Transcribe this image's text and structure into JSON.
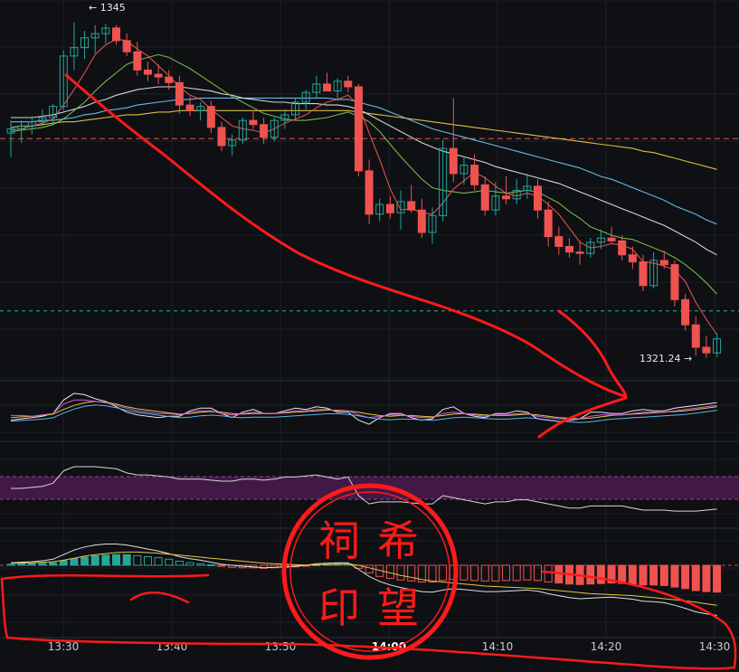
{
  "chart_data": {
    "type": "candlestick",
    "x_ticks": [
      "13:30",
      "13:40",
      "13:50",
      "14:00",
      "14:10",
      "14:20",
      "14:30"
    ],
    "bold_tick": "14:00",
    "annotations": {
      "high_label": "← 1345",
      "low_label": "1321.24 →"
    },
    "reference_lines": {
      "red_dashed": 1336.9,
      "green_dashed": 1324.6
    },
    "colors": {
      "up": "#26a69a",
      "down": "#ef5350",
      "ma5": "#ef5350",
      "ma10": "#7cc14a",
      "ma20": "#e0e0e0",
      "ma30": "#6ec3f4",
      "ma60": "#e8c547",
      "macd_pos": "#26a69a",
      "macd_neg": "#ef5350",
      "rsi_band": "#4a1a4f",
      "annotation_red": "#ff1a1a"
    },
    "candles": [
      [
        1337.3,
        1338.2,
        1335.6,
        1337.6
      ],
      [
        1337.6,
        1338.2,
        1336.6,
        1337.8
      ],
      [
        1337.8,
        1338.5,
        1337.2,
        1338.1
      ],
      [
        1338.1,
        1339.0,
        1337.8,
        1338.4
      ],
      [
        1338.4,
        1339.4,
        1338.0,
        1339.2
      ],
      [
        1339.2,
        1343.2,
        1338.9,
        1342.8
      ],
      [
        1342.8,
        1345.2,
        1341.8,
        1343.4
      ],
      [
        1343.4,
        1344.6,
        1342.6,
        1344.1
      ],
      [
        1344.1,
        1345.0,
        1343.0,
        1344.4
      ],
      [
        1344.4,
        1345.1,
        1343.7,
        1344.8
      ],
      [
        1344.8,
        1345.0,
        1343.6,
        1343.9
      ],
      [
        1343.9,
        1344.4,
        1342.8,
        1343.1
      ],
      [
        1343.1,
        1343.8,
        1341.4,
        1341.8
      ],
      [
        1341.8,
        1342.4,
        1341.0,
        1341.5
      ],
      [
        1341.5,
        1342.2,
        1340.8,
        1341.3
      ],
      [
        1341.3,
        1341.8,
        1340.4,
        1340.9
      ],
      [
        1340.9,
        1341.4,
        1338.7,
        1339.3
      ],
      [
        1339.3,
        1339.9,
        1338.5,
        1338.9
      ],
      [
        1338.9,
        1339.5,
        1338.2,
        1339.2
      ],
      [
        1339.2,
        1339.6,
        1337.3,
        1337.7
      ],
      [
        1337.7,
        1338.1,
        1336.0,
        1336.4
      ],
      [
        1336.4,
        1337.2,
        1335.7,
        1336.8
      ],
      [
        1336.8,
        1338.4,
        1336.5,
        1338.2
      ],
      [
        1338.2,
        1338.9,
        1337.6,
        1337.9
      ],
      [
        1337.9,
        1338.4,
        1336.5,
        1337.0
      ],
      [
        1337.0,
        1338.4,
        1336.7,
        1338.2
      ],
      [
        1338.2,
        1339.0,
        1337.6,
        1338.6
      ],
      [
        1338.6,
        1339.8,
        1338.2,
        1339.5
      ],
      [
        1339.5,
        1340.4,
        1339.0,
        1340.2
      ],
      [
        1340.2,
        1341.4,
        1339.8,
        1340.8
      ],
      [
        1340.8,
        1341.6,
        1340.4,
        1340.3
      ],
      [
        1340.3,
        1341.2,
        1339.6,
        1341.0
      ],
      [
        1341.0,
        1341.4,
        1340.2,
        1340.6
      ],
      [
        1340.6,
        1340.8,
        1334.2,
        1334.6
      ],
      [
        1334.6,
        1335.4,
        1330.8,
        1331.5
      ],
      [
        1331.5,
        1332.6,
        1331.0,
        1332.2
      ],
      [
        1332.2,
        1332.8,
        1331.2,
        1331.6
      ],
      [
        1331.6,
        1333.2,
        1330.4,
        1332.4
      ],
      [
        1332.4,
        1333.6,
        1331.6,
        1331.8
      ],
      [
        1331.8,
        1332.6,
        1329.8,
        1330.2
      ],
      [
        1330.2,
        1332.0,
        1329.4,
        1331.4
      ],
      [
        1331.4,
        1336.8,
        1331.0,
        1336.2
      ],
      [
        1336.2,
        1339.8,
        1333.8,
        1334.4
      ],
      [
        1334.4,
        1335.6,
        1333.6,
        1335.0
      ],
      [
        1335.0,
        1335.8,
        1333.2,
        1333.6
      ],
      [
        1333.6,
        1334.2,
        1331.4,
        1331.8
      ],
      [
        1331.8,
        1333.8,
        1331.4,
        1332.8
      ],
      [
        1332.8,
        1334.2,
        1332.2,
        1332.6
      ],
      [
        1332.6,
        1334.0,
        1332.2,
        1333.2
      ],
      [
        1333.2,
        1334.4,
        1332.6,
        1333.5
      ],
      [
        1333.5,
        1334.0,
        1331.2,
        1331.8
      ],
      [
        1331.8,
        1332.4,
        1329.2,
        1329.9
      ],
      [
        1329.9,
        1330.6,
        1328.6,
        1329.2
      ],
      [
        1329.2,
        1329.8,
        1328.4,
        1328.8
      ],
      [
        1328.8,
        1329.6,
        1327.9,
        1328.7
      ],
      [
        1328.7,
        1329.8,
        1328.4,
        1329.5
      ],
      [
        1329.5,
        1330.4,
        1329.0,
        1329.8
      ],
      [
        1329.8,
        1330.6,
        1329.4,
        1329.6
      ],
      [
        1329.6,
        1330.0,
        1328.2,
        1328.6
      ],
      [
        1328.6,
        1329.2,
        1327.6,
        1328.1
      ],
      [
        1328.1,
        1328.6,
        1326.0,
        1326.4
      ],
      [
        1326.4,
        1328.8,
        1326.2,
        1328.2
      ],
      [
        1328.2,
        1328.9,
        1327.6,
        1327.9
      ],
      [
        1327.9,
        1328.2,
        1324.9,
        1325.4
      ],
      [
        1325.4,
        1325.8,
        1323.2,
        1323.6
      ],
      [
        1323.6,
        1324.2,
        1321.4,
        1322.0
      ],
      [
        1322.0,
        1322.8,
        1321.24,
        1321.6
      ],
      [
        1321.6,
        1323.0,
        1321.3,
        1322.6
      ]
    ],
    "ma5": [
      1337.5,
      1337.6,
      1337.8,
      1338.0,
      1338.3,
      1339.3,
      1340.4,
      1341.6,
      1342.9,
      1343.6,
      1344.0,
      1343.9,
      1343.3,
      1342.8,
      1342.1,
      1341.4,
      1340.6,
      1340.0,
      1339.7,
      1339.0,
      1338.4,
      1337.8,
      1337.6,
      1337.5,
      1337.3,
      1337.6,
      1338.0,
      1338.3,
      1338.6,
      1339.1,
      1339.5,
      1339.7,
      1340.0,
      1339.3,
      1337.3,
      1335.4,
      1333.3,
      1331.8,
      1331.9,
      1331.6,
      1331.5,
      1332.3,
      1333.3,
      1333.9,
      1334.5,
      1334.1,
      1333.5,
      1333.0,
      1332.8,
      1333.0,
      1332.8,
      1332.2,
      1331.5,
      1330.5,
      1329.5,
      1329.1,
      1329.2,
      1329.4,
      1329.3,
      1329.0,
      1328.1,
      1328.0,
      1327.8,
      1327.5,
      1326.7,
      1325.2,
      1324.0,
      1322.9
    ],
    "ma10": [
      1337.4,
      1337.5,
      1337.6,
      1337.7,
      1337.9,
      1338.3,
      1338.9,
      1339.5,
      1340.3,
      1341.0,
      1341.6,
      1342.2,
      1342.5,
      1342.7,
      1342.9,
      1342.7,
      1342.3,
      1341.9,
      1341.4,
      1340.9,
      1340.4,
      1339.9,
      1339.5,
      1339.1,
      1338.7,
      1338.5,
      1338.3,
      1338.2,
      1338.2,
      1338.3,
      1338.4,
      1338.6,
      1338.8,
      1338.5,
      1338.1,
      1337.4,
      1336.5,
      1335.6,
      1334.8,
      1334.0,
      1333.4,
      1333.2,
      1333.1,
      1333.0,
      1333.1,
      1333.2,
      1333.1,
      1333.0,
      1333.1,
      1333.2,
      1333.1,
      1332.7,
      1332.3,
      1331.7,
      1331.2,
      1330.6,
      1330.3,
      1330.0,
      1329.8,
      1329.7,
      1329.4,
      1329.1,
      1328.8,
      1328.4,
      1327.9,
      1327.3,
      1326.6,
      1325.8
    ],
    "ma20": [
      1338.4,
      1338.4,
      1338.4,
      1338.5,
      1338.6,
      1338.8,
      1339.0,
      1339.2,
      1339.5,
      1339.7,
      1340.0,
      1340.2,
      1340.4,
      1340.5,
      1340.6,
      1340.6,
      1340.6,
      1340.5,
      1340.4,
      1340.3,
      1340.1,
      1340.0,
      1339.8,
      1339.7,
      1339.6,
      1339.5,
      1339.5,
      1339.4,
      1339.4,
      1339.4,
      1339.3,
      1339.3,
      1339.2,
      1339.0,
      1338.6,
      1338.2,
      1337.8,
      1337.4,
      1337.0,
      1336.6,
      1336.3,
      1336.0,
      1335.8,
      1335.6,
      1335.4,
      1335.2,
      1334.9,
      1334.7,
      1334.5,
      1334.3,
      1334.1,
      1333.9,
      1333.7,
      1333.4,
      1333.1,
      1332.8,
      1332.5,
      1332.2,
      1331.9,
      1331.6,
      1331.3,
      1331.0,
      1330.7,
      1330.3,
      1329.9,
      1329.5,
      1329.0,
      1328.6
    ],
    "ma30": [
      1338.1,
      1338.1,
      1338.1,
      1338.2,
      1338.2,
      1338.3,
      1338.4,
      1338.6,
      1338.7,
      1338.9,
      1339.0,
      1339.1,
      1339.3,
      1339.4,
      1339.5,
      1339.6,
      1339.7,
      1339.7,
      1339.8,
      1339.8,
      1339.8,
      1339.8,
      1339.8,
      1339.8,
      1339.8,
      1339.8,
      1339.8,
      1339.8,
      1339.8,
      1339.8,
      1339.8,
      1339.7,
      1339.7,
      1339.5,
      1339.3,
      1339.1,
      1338.8,
      1338.5,
      1338.2,
      1337.9,
      1337.6,
      1337.4,
      1337.2,
      1337.0,
      1336.8,
      1336.6,
      1336.4,
      1336.2,
      1336.0,
      1335.8,
      1335.6,
      1335.4,
      1335.2,
      1335.0,
      1334.8,
      1334.5,
      1334.2,
      1334.0,
      1333.7,
      1333.4,
      1333.1,
      1332.8,
      1332.5,
      1332.1,
      1331.8,
      1331.5,
      1331.1,
      1330.8
    ],
    "ma60": [
      1337.7,
      1337.8,
      1337.8,
      1337.9,
      1338.0,
      1338.1,
      1338.1,
      1338.2,
      1338.3,
      1338.4,
      1338.5,
      1338.6,
      1338.6,
      1338.7,
      1338.8,
      1338.8,
      1338.9,
      1338.9,
      1338.9,
      1338.9,
      1338.9,
      1338.9,
      1338.9,
      1338.9,
      1338.9,
      1338.9,
      1338.9,
      1338.9,
      1338.9,
      1338.9,
      1338.9,
      1338.9,
      1338.9,
      1338.8,
      1338.7,
      1338.6,
      1338.5,
      1338.4,
      1338.3,
      1338.2,
      1338.1,
      1338.0,
      1337.9,
      1337.8,
      1337.7,
      1337.6,
      1337.5,
      1337.4,
      1337.3,
      1337.2,
      1337.1,
      1337.0,
      1336.9,
      1336.8,
      1336.7,
      1336.6,
      1336.5,
      1336.4,
      1336.3,
      1336.2,
      1336.0,
      1335.9,
      1335.7,
      1335.5,
      1335.3,
      1335.1,
      1334.9,
      1334.7
    ],
    "stoch_k": [
      55,
      55,
      54,
      56,
      58,
      72,
      78,
      78,
      76,
      74,
      70,
      66,
      62,
      60,
      58,
      58,
      56,
      60,
      62,
      62,
      58,
      56,
      58,
      60,
      58,
      58,
      60,
      62,
      62,
      64,
      64,
      62,
      62,
      56,
      52,
      54,
      56,
      56,
      54,
      52,
      52,
      58,
      60,
      58,
      56,
      54,
      56,
      56,
      58,
      58,
      54,
      52,
      50,
      50,
      50,
      54,
      56,
      56,
      56,
      58,
      60,
      60,
      60,
      62,
      64,
      66,
      68,
      70
    ],
    "stoch_d": [
      52,
      53,
      54,
      55,
      57,
      64,
      70,
      74,
      76,
      75,
      72,
      68,
      65,
      63,
      61,
      59,
      57,
      58,
      60,
      61,
      60,
      58,
      57,
      58,
      58,
      58,
      59,
      60,
      61,
      62,
      63,
      63,
      62,
      60,
      57,
      55,
      54,
      55,
      55,
      54,
      53,
      55,
      57,
      58,
      57,
      56,
      55,
      55,
      56,
      57,
      56,
      54,
      52,
      51,
      50,
      51,
      53,
      55,
      56,
      57,
      58,
      59,
      60,
      61,
      62,
      64,
      66,
      68
    ],
    "stoch_j": [
      48,
      50,
      52,
      54,
      58,
      78,
      88,
      86,
      80,
      76,
      68,
      60,
      56,
      54,
      52,
      54,
      54,
      62,
      66,
      66,
      58,
      52,
      60,
      64,
      58,
      58,
      62,
      66,
      64,
      68,
      66,
      60,
      60,
      48,
      42,
      52,
      58,
      58,
      52,
      48,
      50,
      64,
      68,
      58,
      54,
      52,
      58,
      58,
      62,
      60,
      50,
      48,
      46,
      48,
      50,
      60,
      60,
      58,
      58,
      62,
      64,
      62,
      62,
      66,
      68,
      70,
      72,
      74
    ],
    "rsi": [
      55,
      55,
      56,
      57,
      60,
      72,
      76,
      76,
      76,
      75,
      74,
      70,
      68,
      68,
      67,
      66,
      64,
      64,
      64,
      63,
      62,
      62,
      64,
      64,
      63,
      64,
      66,
      66,
      67,
      68,
      66,
      64,
      66,
      48,
      40,
      42,
      42,
      42,
      41,
      40,
      40,
      48,
      46,
      44,
      42,
      40,
      42,
      42,
      44,
      44,
      42,
      40,
      38,
      36,
      36,
      38,
      38,
      38,
      38,
      36,
      34,
      34,
      34,
      33,
      33,
      33,
      34,
      35
    ],
    "macd_hist": [
      0.04,
      0.05,
      0.06,
      0.08,
      0.1,
      0.18,
      0.26,
      0.32,
      0.38,
      0.4,
      0.42,
      0.42,
      0.38,
      0.34,
      0.3,
      0.24,
      0.16,
      0.1,
      0.06,
      0.02,
      -0.04,
      -0.08,
      -0.1,
      -0.1,
      -0.12,
      -0.1,
      -0.08,
      -0.06,
      -0.02,
      0.02,
      0.04,
      0.06,
      0.06,
      -0.12,
      -0.3,
      -0.44,
      -0.52,
      -0.58,
      -0.62,
      -0.66,
      -0.66,
      -0.6,
      -0.56,
      -0.58,
      -0.6,
      -0.62,
      -0.62,
      -0.6,
      -0.6,
      -0.58,
      -0.6,
      -0.66,
      -0.7,
      -0.74,
      -0.76,
      -0.74,
      -0.72,
      -0.7,
      -0.72,
      -0.74,
      -0.78,
      -0.78,
      -0.8,
      -0.86,
      -0.92,
      -1.0,
      -1.04,
      -1.06
    ],
    "macd_dif": [
      0.1,
      0.12,
      0.14,
      0.18,
      0.24,
      0.42,
      0.6,
      0.72,
      0.8,
      0.84,
      0.84,
      0.8,
      0.72,
      0.64,
      0.56,
      0.46,
      0.34,
      0.26,
      0.2,
      0.12,
      0.04,
      0.0,
      -0.04,
      -0.06,
      -0.1,
      -0.08,
      -0.06,
      -0.04,
      0.0,
      0.06,
      0.08,
      0.1,
      0.1,
      -0.16,
      -0.44,
      -0.64,
      -0.78,
      -0.88,
      -0.96,
      -1.04,
      -1.06,
      -0.98,
      -0.92,
      -0.96,
      -1.0,
      -1.04,
      -1.04,
      -1.02,
      -1.0,
      -0.98,
      -1.02,
      -1.12,
      -1.2,
      -1.28,
      -1.32,
      -1.3,
      -1.28,
      -1.26,
      -1.3,
      -1.34,
      -1.42,
      -1.44,
      -1.48,
      -1.58,
      -1.7,
      -1.84,
      -1.92,
      -1.98
    ],
    "macd_dea": [
      0.08,
      0.09,
      0.1,
      0.12,
      0.14,
      0.2,
      0.28,
      0.36,
      0.42,
      0.46,
      0.5,
      0.52,
      0.52,
      0.5,
      0.48,
      0.44,
      0.4,
      0.36,
      0.32,
      0.28,
      0.24,
      0.2,
      0.16,
      0.12,
      0.08,
      0.06,
      0.04,
      0.02,
      0.01,
      0.02,
      0.03,
      0.04,
      0.05,
      0.0,
      -0.1,
      -0.2,
      -0.3,
      -0.4,
      -0.48,
      -0.56,
      -0.62,
      -0.66,
      -0.7,
      -0.74,
      -0.78,
      -0.82,
      -0.84,
      -0.86,
      -0.88,
      -0.9,
      -0.92,
      -0.96,
      -1.0,
      -1.04,
      -1.08,
      -1.12,
      -1.14,
      -1.16,
      -1.18,
      -1.2,
      -1.24,
      -1.28,
      -1.32,
      -1.36,
      -1.4,
      -1.46,
      -1.52,
      -1.58
    ]
  },
  "stamp": {
    "chars": [
      "祠",
      "希",
      "印",
      "望"
    ],
    "color": "#ff1a1a"
  }
}
